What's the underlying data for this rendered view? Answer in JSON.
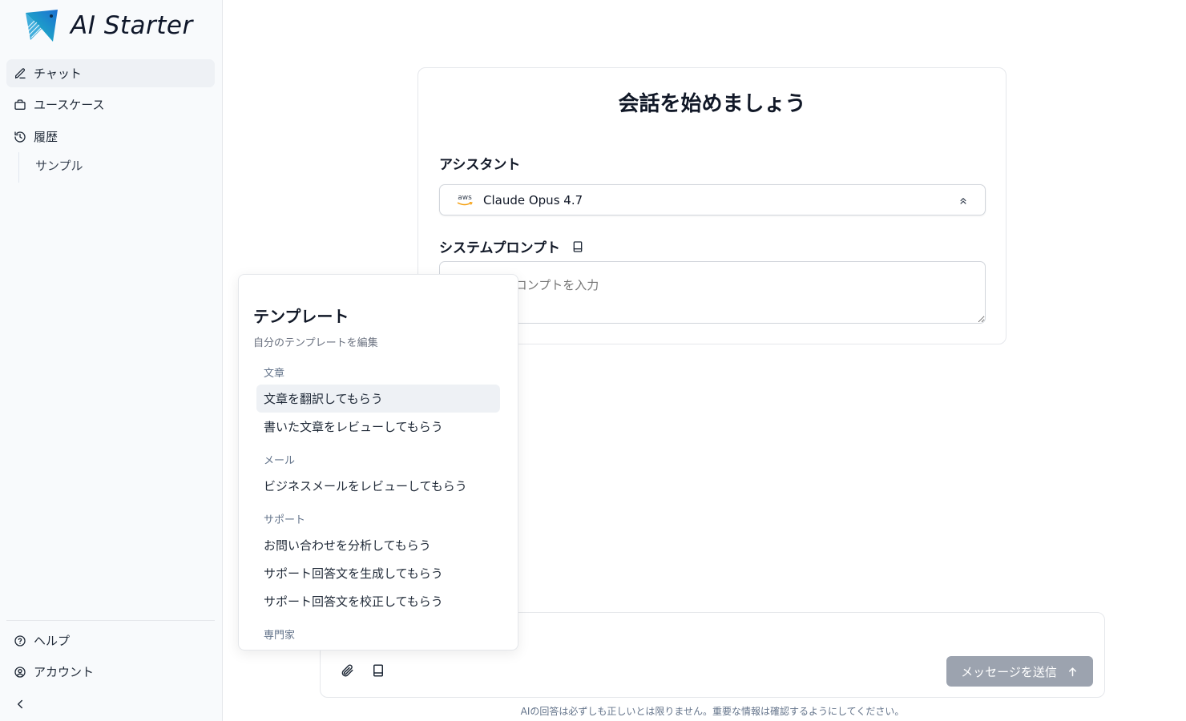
{
  "app": {
    "logo_text": "AI Starter"
  },
  "sidebar": {
    "items": [
      {
        "label": "チャット",
        "icon": "edit-icon"
      },
      {
        "label": "ユースケース",
        "icon": "briefcase-icon"
      },
      {
        "label": "履歴",
        "icon": "history-icon"
      }
    ],
    "history_items": [
      "サンプル"
    ],
    "bottom_items": [
      {
        "label": "ヘルプ",
        "icon": "help-circle-icon"
      },
      {
        "label": "アカウント",
        "icon": "user-circle-icon"
      }
    ],
    "collapse_icon": "chevron-left-icon"
  },
  "main": {
    "title": "会話を始めましょう",
    "assistant_label": "アシスタント",
    "model": {
      "provider_icon": "aws-logo",
      "provider_text": "aws",
      "name": "Claude Opus 4.7"
    },
    "system_prompt_label": "システムプロンプト",
    "system_prompt_placeholder": "システムプロンプトを入力"
  },
  "template_popup": {
    "title": "テンプレート",
    "subtitle": "自分のテンプレートを編集",
    "groups": [
      {
        "label": "文章",
        "items": [
          "文章を翻訳してもらう",
          "書いた文章をレビューしてもらう"
        ]
      },
      {
        "label": "メール",
        "items": [
          "ビジネスメールをレビューしてもらう"
        ]
      },
      {
        "label": "サポート",
        "items": [
          "お問い合わせを分析してもらう",
          "サポート回答文を生成してもらう",
          "サポート回答文を校正してもらう"
        ]
      },
      {
        "label": "専門家",
        "items": []
      }
    ]
  },
  "composer": {
    "send_label": "メッセージを送信",
    "disclaimer": "AIの回答は必ずしも正しいとは限りません。重要な情報は確認するようにしてください。"
  },
  "colors": {
    "accent": "#1e90c8",
    "send_disabled": "#9ca3af",
    "active_bg": "#eef1f5"
  }
}
